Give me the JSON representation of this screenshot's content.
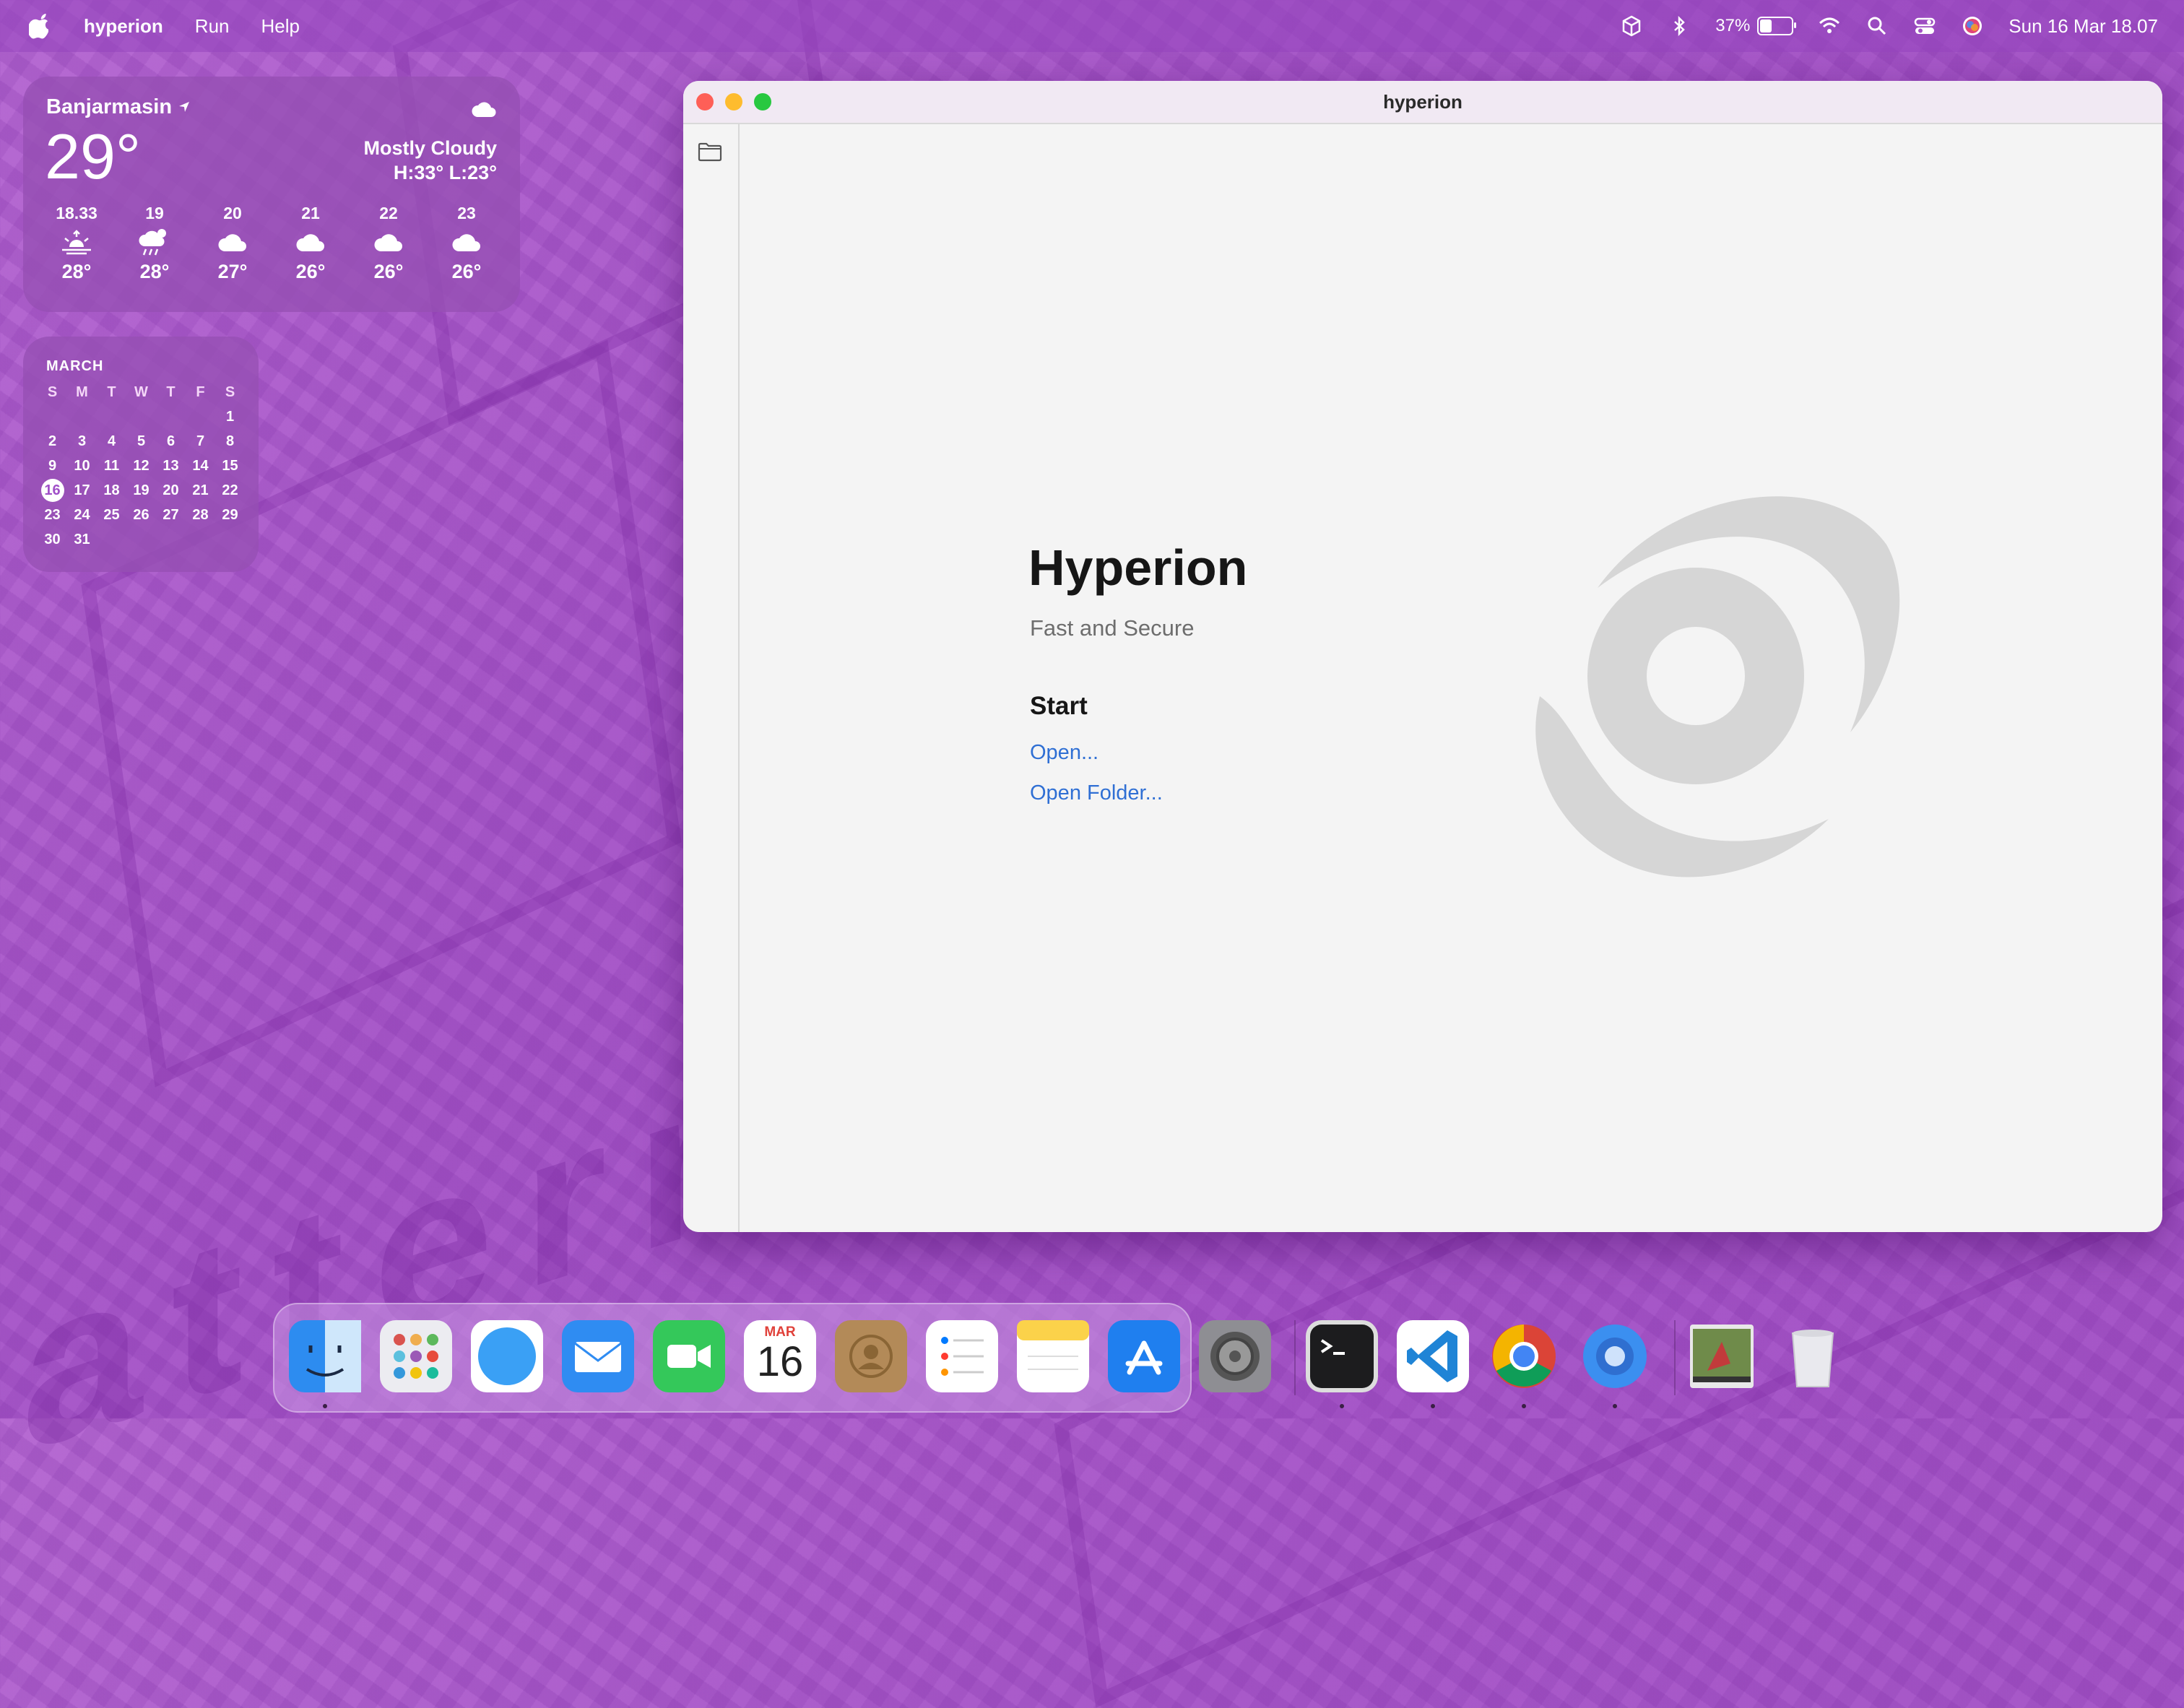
{
  "menubar": {
    "app_name": "hyperion",
    "items": [
      "Run",
      "Help"
    ],
    "battery_percent": "37%",
    "battery_level": 0.37,
    "datetime": "Sun 16 Mar  18.07"
  },
  "weather": {
    "city": "Banjarmasin",
    "temperature": "29°",
    "condition": "Mostly Cloudy",
    "high_low": "H:33° L:23°",
    "forecast": [
      {
        "time": "18.33",
        "icon": "sunset-icon",
        "temp": "28°"
      },
      {
        "time": "19",
        "icon": "rain-cloud-icon",
        "temp": "28°"
      },
      {
        "time": "20",
        "icon": "cloud-icon",
        "temp": "27°"
      },
      {
        "time": "21",
        "icon": "cloud-icon",
        "temp": "26°"
      },
      {
        "time": "22",
        "icon": "cloud-icon",
        "temp": "26°"
      },
      {
        "time": "23",
        "icon": "cloud-icon",
        "temp": "26°"
      }
    ]
  },
  "calendar": {
    "month": "MARCH",
    "weekdays": [
      "S",
      "M",
      "T",
      "W",
      "T",
      "F",
      "S"
    ],
    "days": [
      "",
      "",
      "",
      "",
      "",
      "",
      "1",
      "2",
      "3",
      "4",
      "5",
      "6",
      "7",
      "8",
      "9",
      "10",
      "11",
      "12",
      "13",
      "14",
      "15",
      "16",
      "17",
      "18",
      "19",
      "20",
      "21",
      "22",
      "23",
      "24",
      "25",
      "26",
      "27",
      "28",
      "29",
      "30",
      "31",
      "",
      "",
      "",
      "",
      ""
    ],
    "today": "16"
  },
  "window": {
    "title": "hyperion",
    "app_title": "Hyperion",
    "subtitle": "Fast and Secure",
    "start_heading": "Start",
    "open_link": "Open...",
    "open_folder_link": "Open Folder..."
  },
  "dock": {
    "items": [
      {
        "name": "finder",
        "color": "#2d8cf0",
        "running": true
      },
      {
        "name": "launchpad",
        "color": "#e9e9ee",
        "running": false
      },
      {
        "name": "safari",
        "color": "#3aa0f5",
        "running": false
      },
      {
        "name": "mail",
        "color": "#2f8cf2",
        "running": false
      },
      {
        "name": "facetime",
        "color": "#34c85a",
        "running": false
      },
      {
        "name": "calendar",
        "color": "#ffffff",
        "running": false
      },
      {
        "name": "contacts",
        "color": "#b38a58",
        "running": false
      },
      {
        "name": "reminders",
        "color": "#ffffff",
        "running": false
      },
      {
        "name": "notes",
        "color": "#fbe27a",
        "running": false
      },
      {
        "name": "app-store",
        "color": "#1f7fef",
        "running": false
      },
      {
        "name": "system-settings",
        "color": "#8e8e93",
        "running": false
      },
      {
        "name": "terminal",
        "color": "#1c1c1e",
        "running": true
      },
      {
        "name": "vscode",
        "color": "#ffffff",
        "running": true
      },
      {
        "name": "chrome",
        "color": "#ffffff",
        "running": true
      },
      {
        "name": "hyperion",
        "color": "#3b8ff0",
        "running": true
      },
      {
        "name": "preview-image",
        "color": "#6f8b4a",
        "running": false
      },
      {
        "name": "trash",
        "color": "#e6e6ea",
        "running": false
      }
    ],
    "calendar_month": "MAR",
    "calendar_day": "16"
  }
}
